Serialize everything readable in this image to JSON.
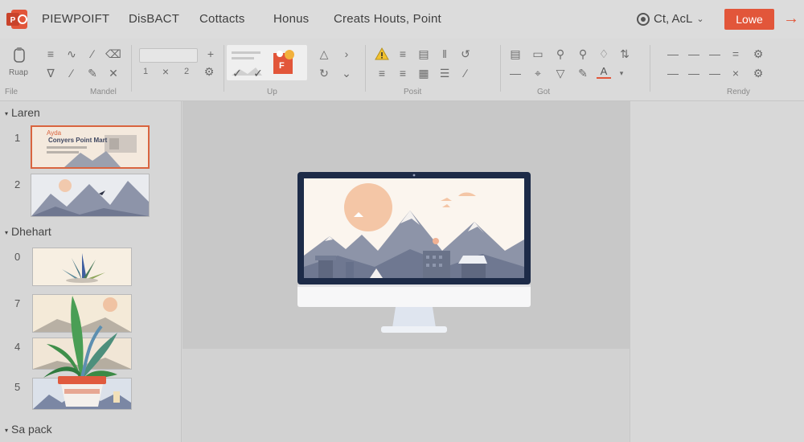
{
  "app": {
    "logo_icon": "powerpoint-logo",
    "accent": "#e2563a"
  },
  "menu": {
    "items": [
      "PIEWPOIFT",
      "DisBACT",
      "Cottacts",
      "Honus",
      "Creats Houts, Point"
    ]
  },
  "account": {
    "name": "Ct, AcL",
    "login_label": "Lowe",
    "arrow_icon": "arrow-right-icon"
  },
  "ribbon": {
    "groups": [
      {
        "label": "File"
      },
      {
        "label": "Mandel"
      },
      {
        "label": "Up"
      },
      {
        "label": "Posit"
      },
      {
        "label": "Got"
      },
      {
        "label": "Rendy"
      }
    ],
    "paste_label": "Ruap",
    "font_numbers": [
      "1",
      "2"
    ],
    "style_badge": "F"
  },
  "slides": {
    "section1": "Laren",
    "section2": "Dhehart",
    "section3": "Sa pack",
    "numbers": [
      "1",
      "2",
      "0",
      "7",
      "4",
      "5"
    ],
    "thumb1_tag": "Ayda",
    "thumb1_title": "Conyers Point Mart"
  },
  "colors": {
    "background": "#d4d4d4",
    "canvas": "#c8c8c8",
    "monitor_frame": "#1d2b48",
    "sun": "#f4c6a6",
    "mountain": "#8c93a8"
  }
}
